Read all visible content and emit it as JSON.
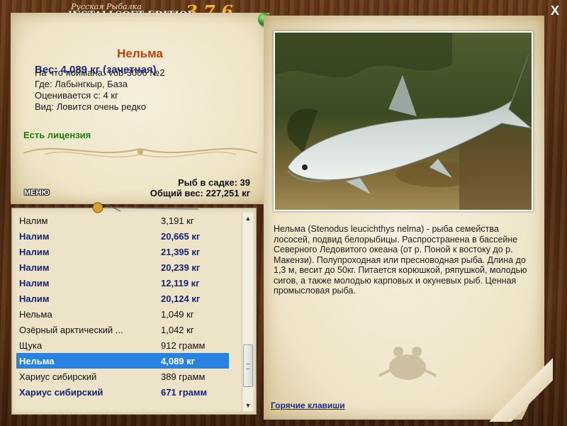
{
  "window": {
    "title_small": "Русская Рыбалка",
    "title_main": "INSTALLSOFT EDITION",
    "version": "3.7.6",
    "close_label": "X"
  },
  "catch": {
    "name": "Нельма",
    "weight": "Вес: 4,089 кг (зачетная)",
    "bait": "На что поймана: Vob-3006 №2",
    "location": "Где: Лабынгкыр, База",
    "rating": "Оценивается с: 4 кг",
    "rarity": "Вид: Ловится очень редко",
    "license": "Есть лицензия"
  },
  "stats": {
    "fish_in_keepnet": "Рыб в садке: 39",
    "total_weight": "Общий вес: 227,251 кг"
  },
  "menu": {
    "label": "МЕНЮ"
  },
  "keepnet_list": [
    {
      "name": "Налим",
      "weight": "3,191 кг",
      "bold": false,
      "selected": false
    },
    {
      "name": "Налим",
      "weight": "20,665 кг",
      "bold": true,
      "selected": false
    },
    {
      "name": "Налим",
      "weight": "21,395 кг",
      "bold": true,
      "selected": false
    },
    {
      "name": "Налим",
      "weight": "20,239 кг",
      "bold": true,
      "selected": false
    },
    {
      "name": "Налим",
      "weight": "12,119 кг",
      "bold": true,
      "selected": false
    },
    {
      "name": "Налим",
      "weight": "20,124 кг",
      "bold": true,
      "selected": false
    },
    {
      "name": "Нельма",
      "weight": "1,049 кг",
      "bold": false,
      "selected": false
    },
    {
      "name": "Озёрный арктический ...",
      "weight": "1,042 кг",
      "bold": false,
      "selected": false
    },
    {
      "name": "Щука",
      "weight": "912 грамм",
      "bold": false,
      "selected": false
    },
    {
      "name": "Нельма",
      "weight": "4,089 кг",
      "bold": true,
      "selected": true
    },
    {
      "name": "Хариус сибирский",
      "weight": "389 грамм",
      "bold": false,
      "selected": false
    },
    {
      "name": "Хариус сибирский",
      "weight": "671 грамм",
      "bold": true,
      "selected": false
    }
  ],
  "description": "Нельма (Stenodus leucichthys nelma) - рыба семейства лососей, подвид белорыбицы. Распространена в бассейне Северного Ледовитого океана (от р. Поной к востоку до р. Макензи). Полупроходная или пресноводная рыба. Длина до 1,3 м, весит до 50кг. Питается корюшкой, ряпушкой, молодью сигов, а также молодью карповых и окуневых рыб. Ценная промысловая рыба.",
  "hotkeys_label": "Горячие клавиши",
  "colors": {
    "title_accent": "#f2b531",
    "fish_name": "#b2450f",
    "weight_text": "#1b2f8a",
    "license_text": "#1f7a12",
    "selection": "#2a82e0"
  },
  "icons": {
    "close": "close-icon",
    "pin": "pushpin-icon",
    "scroll_up": "arrow-up-icon",
    "scroll_down": "arrow-down-icon"
  }
}
